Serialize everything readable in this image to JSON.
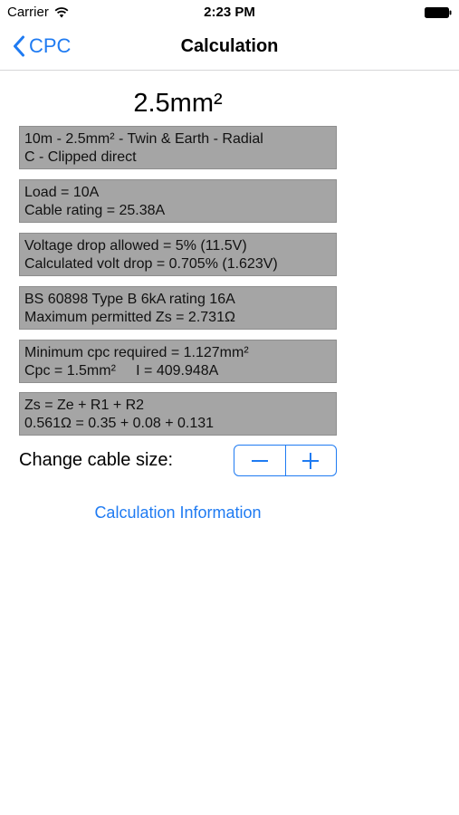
{
  "status_bar": {
    "carrier": "Carrier",
    "time": "2:23 PM"
  },
  "nav": {
    "back_label": "CPC",
    "title": "Calculation"
  },
  "cable_size": "2.5mm²",
  "boxes": [
    {
      "line1": "10m - 2.5mm² - Twin & Earth - Radial",
      "line2": "C - Clipped direct"
    },
    {
      "line1": "Load = 10A",
      "line2": "Cable rating = 25.38A"
    },
    {
      "line1": "Voltage drop allowed = 5% (11.5V)",
      "line2": "Calculated volt drop = 0.705% (1.623V)"
    },
    {
      "line1": "BS 60898 Type B 6kA rating 16A",
      "line2": "Maximum permitted Zs = 2.731Ω"
    },
    {
      "line1": "Minimum cpc required = 1.127mm²",
      "line2": "Cpc = 1.5mm²     I = 409.948A"
    },
    {
      "line1": "Zs = Ze + R1 + R2",
      "line2": "0.561Ω = 0.35 + 0.08 + 0.131"
    }
  ],
  "change_label": "Change cable size:",
  "calc_info_link": "Calculation Information",
  "colors": {
    "accent": "#1f7bf2",
    "box_bg": "#a5a5a5"
  },
  "icons": {
    "back": "chevron-left-icon",
    "wifi": "wifi-icon",
    "battery": "battery-icon",
    "minus": "minus-icon",
    "plus": "plus-icon"
  }
}
